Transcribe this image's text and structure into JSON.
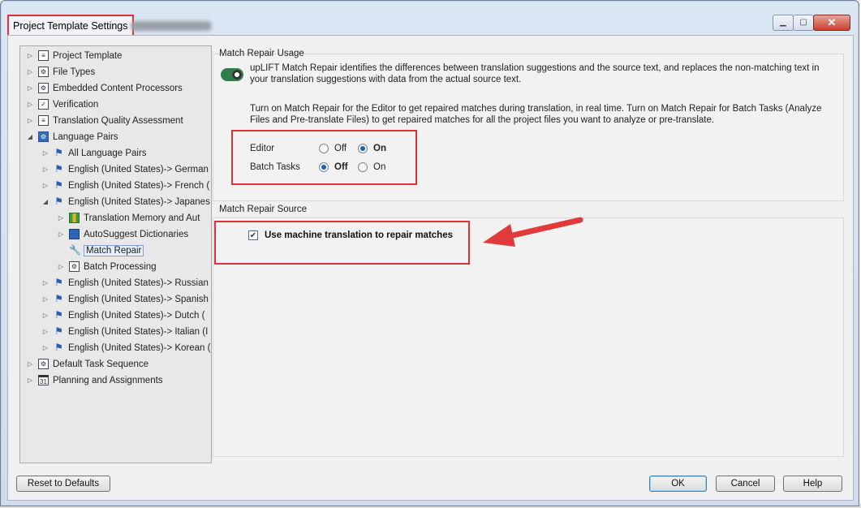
{
  "window": {
    "title": "Project Template Settings",
    "controls": {
      "minimize": "▁",
      "maximize": "▢",
      "close": "✕"
    }
  },
  "tree": {
    "items": [
      {
        "label": "Project Template",
        "icon": "project-template-icon",
        "glyph": "≡"
      },
      {
        "label": "File Types",
        "icon": "file-types-icon",
        "glyph": "⚙"
      },
      {
        "label": "Embedded Content Processors",
        "icon": "embedded-content-icon",
        "glyph": "⚙"
      },
      {
        "label": "Verification",
        "icon": "verification-icon",
        "glyph": "✓"
      },
      {
        "label": "Translation Quality Assessment",
        "icon": "tqa-icon",
        "glyph": "≡"
      },
      {
        "label": "Language Pairs",
        "icon": "language-pairs-icon",
        "glyph": "⚙"
      },
      {
        "label": "All Language Pairs",
        "icon": "flag-icon",
        "glyph": "⚑"
      },
      {
        "label": "English (United States)-> German",
        "icon": "flag-icon",
        "glyph": "⚑"
      },
      {
        "label": "English (United States)-> French (",
        "icon": "flag-icon",
        "glyph": "⚑"
      },
      {
        "label": "English (United States)-> Japanes",
        "icon": "flag-icon",
        "glyph": "⚑"
      },
      {
        "label": "Translation Memory and Aut",
        "icon": "translation-memory-icon",
        "glyph": ""
      },
      {
        "label": "AutoSuggest Dictionaries",
        "icon": "autosuggest-icon",
        "glyph": ""
      },
      {
        "label": "Match Repair",
        "icon": "wrench-icon",
        "glyph": "🔧"
      },
      {
        "label": "Batch Processing",
        "icon": "batch-processing-icon",
        "glyph": "⚙"
      },
      {
        "label": "English (United States)-> Russian",
        "icon": "flag-icon",
        "glyph": "⚑"
      },
      {
        "label": "English (United States)-> Spanish",
        "icon": "flag-icon",
        "glyph": "⚑"
      },
      {
        "label": "English (United States)-> Dutch (",
        "icon": "flag-icon",
        "glyph": "⚑"
      },
      {
        "label": "English (United States)-> Italian (I",
        "icon": "flag-icon",
        "glyph": "⚑"
      },
      {
        "label": "English (United States)-> Korean (",
        "icon": "flag-icon",
        "glyph": "⚑"
      },
      {
        "label": "Default Task Sequence",
        "icon": "task-sequence-icon",
        "glyph": "⚙"
      },
      {
        "label": "Planning and Assignments",
        "icon": "calendar-icon",
        "glyph": "31"
      }
    ]
  },
  "usage": {
    "title": "Match Repair Usage",
    "description": "upLIFT Match Repair identifies the differences between translation suggestions and the source text, and replaces the non-matching text in your translation suggestions with data from the actual source text.",
    "instructions": "Turn on Match Repair for the Editor to get repaired matches during translation, in real time. Turn on Match Repair for Batch Tasks (Analyze Files and Pre-translate Files) to get repaired matches for all the project files you want to analyze or pre-translate.",
    "editor_label": "Editor",
    "batch_label": "Batch Tasks",
    "off_label": "Off",
    "on_label": "On",
    "editor_value": "On",
    "batch_value": "Off"
  },
  "source": {
    "title": "Match Repair Source",
    "checkbox_label": "Use machine translation to repair matches",
    "checked": true,
    "check_glyph": "✔"
  },
  "buttons": {
    "reset": "Reset to Defaults",
    "ok": "OK",
    "cancel": "Cancel",
    "help": "Help"
  }
}
